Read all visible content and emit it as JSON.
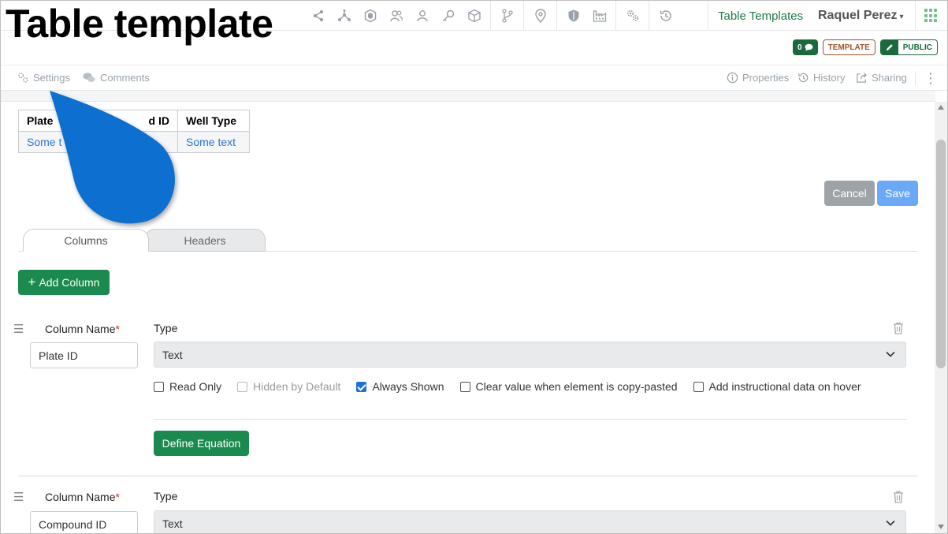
{
  "overlay_title": "Table template",
  "nav": {
    "templates_link": "Table Templates",
    "user_name": "Raquel Perez",
    "icons": [
      "share-icon",
      "network-icon",
      "hexagon-icon",
      "users-icon",
      "user-icon",
      "key-icon",
      "cube-icon",
      "branch-icon",
      "location-pin-icon",
      "shield-icon",
      "factory-icon",
      "gears-icon",
      "history-icon"
    ]
  },
  "badges": {
    "count": "0",
    "template": "TEMPLATE",
    "public": "PUBLIC"
  },
  "subbar": {
    "settings": "Settings",
    "comments": "Comments",
    "properties": "Properties",
    "history": "History",
    "sharing": "Sharing"
  },
  "preview_table": {
    "headers": [
      "Plate ID",
      "Compound ID",
      "Well Type"
    ],
    "header_visible": [
      "Plate",
      "d ID",
      "Well Type"
    ],
    "row": [
      "Some t",
      "",
      "Some text"
    ]
  },
  "actions": {
    "cancel": "Cancel",
    "save": "Save"
  },
  "tabs": {
    "columns": "Columns",
    "headers": "Headers"
  },
  "add_column": "Add Column",
  "column_editor": {
    "name_label": "Column Name",
    "required_mark": "*",
    "type_label": "Type"
  },
  "columns": [
    {
      "name": "Plate ID",
      "type": "Text",
      "options": [
        {
          "label": "Read Only",
          "checked": false,
          "disabled": false
        },
        {
          "label": "Hidden by Default",
          "checked": false,
          "disabled": true
        },
        {
          "label": "Always Shown",
          "checked": true,
          "disabled": false
        },
        {
          "label": "Clear value when element is copy-pasted",
          "checked": false,
          "disabled": false
        },
        {
          "label": "Add instructional data on hover",
          "checked": false,
          "disabled": false
        }
      ],
      "define_equation": "Define Equation"
    },
    {
      "name": "Compound ID",
      "type": "Text"
    }
  ],
  "colors": {
    "primary_green": "#1b8a4e",
    "save_blue": "#6aa9f7",
    "cancel_gray": "#9ea3a8",
    "annotation_blue": "#0a6fd0",
    "link_blue": "#2a76d2"
  }
}
